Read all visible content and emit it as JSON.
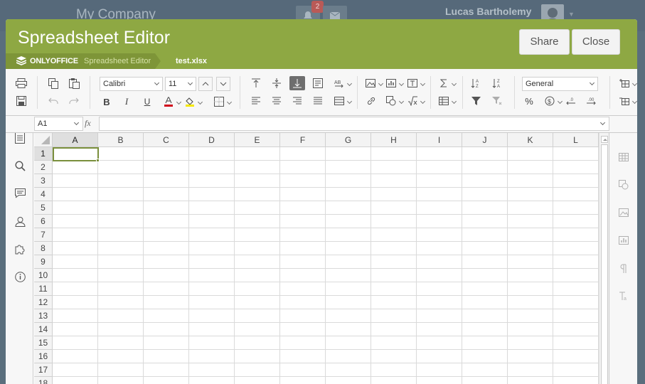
{
  "portal": {
    "company": "My Company",
    "notification_count": "2",
    "user_name": "Lucas Bartholemy"
  },
  "window": {
    "title": "Spreadsheet Editor",
    "share_label": "Share",
    "close_label": "Close"
  },
  "breadcrumb": {
    "brand": "ONLYOFFICE",
    "app": "Spreadsheet Editor",
    "file": "test.xlsx"
  },
  "toolbar": {
    "font_name": "Calibri",
    "font_size": "11",
    "number_format": "General",
    "bold": "B",
    "italic": "I",
    "underline": "U",
    "font_color": "#d0021b",
    "highlight_color": "#f5e800"
  },
  "formula_bar": {
    "cell_ref": "A1",
    "fx": "fx",
    "formula": ""
  },
  "sheet": {
    "columns": [
      "A",
      "B",
      "C",
      "D",
      "E",
      "F",
      "G",
      "H",
      "I",
      "J",
      "K",
      "L"
    ],
    "rows": [
      "1",
      "2",
      "3",
      "4",
      "5",
      "6",
      "7",
      "8",
      "9",
      "10",
      "11",
      "12",
      "13",
      "14",
      "15",
      "16",
      "17",
      "18"
    ],
    "selected_cell": "A1"
  },
  "colors": {
    "accent": "#8ea843",
    "selection": "#7a8f3c"
  }
}
